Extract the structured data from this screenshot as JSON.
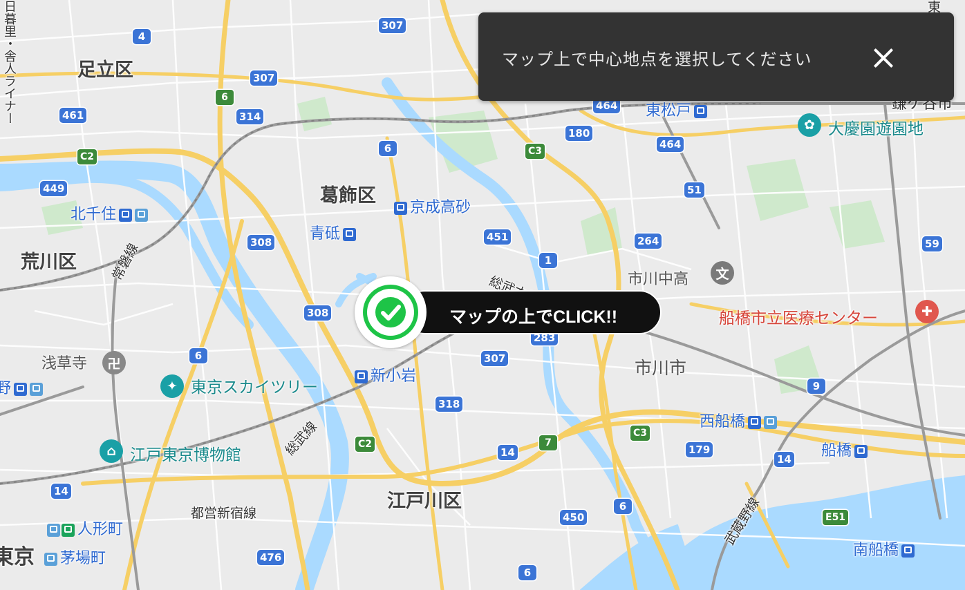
{
  "toast": {
    "message": "マップ上で中心地点を選択してください"
  },
  "marker": {
    "label": "マップの上でCLICK!!"
  },
  "colors": {
    "water": "#aadaff",
    "park": "#c5e8c5",
    "expressway": "#f6cf65",
    "arterial": "#ffffff",
    "rail": "#9a9a9a",
    "toast_bg": "#333333",
    "marker_green": "#1ec447"
  },
  "wards": [
    "足立区",
    "葛飾区",
    "荒川区",
    "江戸川区"
  ],
  "cities": [
    "市川市"
  ],
  "stations": [
    "北千住",
    "京成高砂",
    "青砥",
    "新小岩",
    "東松戸",
    "西船橋",
    "船橋",
    "南船橋",
    "人形町",
    "茅場町",
    "野"
  ],
  "pois": [
    {
      "name": "大慶園遊園地",
      "icon": "park-icon"
    },
    {
      "name": "東京スカイツリー",
      "icon": "landmark-icon"
    },
    {
      "name": "江戸東京博物館",
      "icon": "museum-icon"
    },
    {
      "name": "浅草寺",
      "icon": "temple-icon"
    },
    {
      "name": "市川中高",
      "icon": "school-icon"
    },
    {
      "name": "船橋市立医療センター",
      "icon": "hospital-icon"
    }
  ],
  "rail_lines": [
    "常磐線",
    "総武線",
    "総武本線",
    "都営新宿線",
    "武蔵野線",
    "日暮里・舎人ライナー"
  ],
  "edge_text": {
    "tokyo": "東京",
    "top_right": "東",
    "top_right2": "鎌ケ谷市"
  },
  "route_shields": [
    "307",
    "4",
    "307",
    "6",
    "314",
    "461",
    "449",
    "C2",
    "6",
    "308",
    "308",
    "451",
    "1",
    "264",
    "51",
    "180",
    "464",
    "464",
    "C3",
    "59",
    "9",
    "6",
    "307",
    "318",
    "C2",
    "14",
    "7",
    "C3",
    "179",
    "14",
    "14",
    "6",
    "450",
    "476",
    "6",
    "E51",
    "283",
    "51"
  ]
}
